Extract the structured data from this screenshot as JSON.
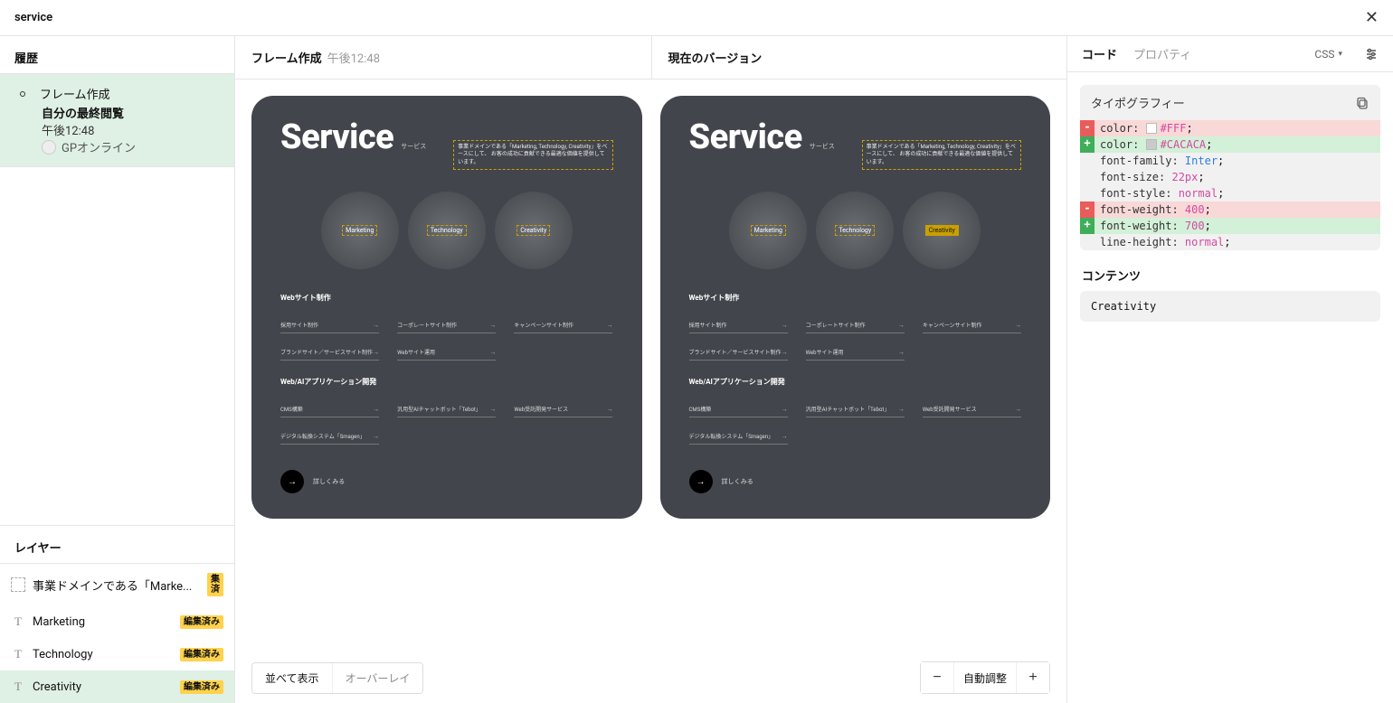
{
  "titlebar": {
    "title": "service"
  },
  "left": {
    "history_title": "履歴",
    "item": {
      "action": "フレーム作成",
      "subtitle": "自分の最終閲覧",
      "time": "午後12:48",
      "user": "GPオンライン"
    },
    "layers_title": "レイヤー",
    "layers": [
      {
        "name": "事業ドメインである「Marke...",
        "badge": "集済",
        "icon": "frame",
        "selected": false,
        "badge_stack": true
      },
      {
        "name": "Marketing",
        "badge": "編集済み",
        "icon": "text",
        "selected": false
      },
      {
        "name": "Technology",
        "badge": "編集済み",
        "icon": "text",
        "selected": false
      },
      {
        "name": "Creativity",
        "badge": "編集済み",
        "icon": "text",
        "selected": true
      }
    ]
  },
  "center": {
    "pane1": {
      "label": "フレーム作成",
      "meta": "午後12:48"
    },
    "pane2": {
      "label": "現在のバージョン"
    },
    "footer": {
      "tab_side": "並べて表示",
      "tab_overlay": "オーバーレイ",
      "zoom_label": "自動調整"
    }
  },
  "card": {
    "title": "Service",
    "subtitle": "サービス",
    "desc": "事業ドメインである「Marketing, Technology, Creativity」をベースにして、 お客の成功に貢献できる最適な価値を提供しています。",
    "circles": [
      "Marketing",
      "Technology",
      "Creativity"
    ],
    "section1_title": "Webサイト制作",
    "section1_items": [
      "採用サイト制作",
      "コーポレートサイト制作",
      "キャンペーンサイト制作",
      "ブランドサイト／サービスサイト制作",
      "Webサイト運用"
    ],
    "section2_title": "Web/AIアプリケーション開発",
    "section2_items": [
      "CMS構築",
      "汎用型AIチャットボット「Tebot」",
      "Web受託開発サービス",
      "デジタル転換システム「Smagen」"
    ],
    "more_label": "詳しくみる"
  },
  "right": {
    "tab_code": "コード",
    "tab_props": "プロパティ",
    "lang": "CSS",
    "typography_title": "タイポグラフィー",
    "lines": [
      {
        "kind": "removed",
        "prop": "color",
        "value": "#FFF",
        "swatch": "#FFFFFF"
      },
      {
        "kind": "added",
        "prop": "color",
        "value": "#CACACA",
        "swatch": "#CACACA"
      },
      {
        "kind": "plain",
        "prop": "font-family",
        "ident": "Inter"
      },
      {
        "kind": "plain",
        "prop": "font-size",
        "value": "22px"
      },
      {
        "kind": "plain",
        "prop": "font-style",
        "value": "normal"
      },
      {
        "kind": "removed",
        "prop": "font-weight",
        "value": "400"
      },
      {
        "kind": "added",
        "prop": "font-weight",
        "value": "700"
      },
      {
        "kind": "plain",
        "prop": "line-height",
        "value": "normal"
      }
    ],
    "contents_title": "コンテンツ",
    "contents_value": "Creativity"
  }
}
